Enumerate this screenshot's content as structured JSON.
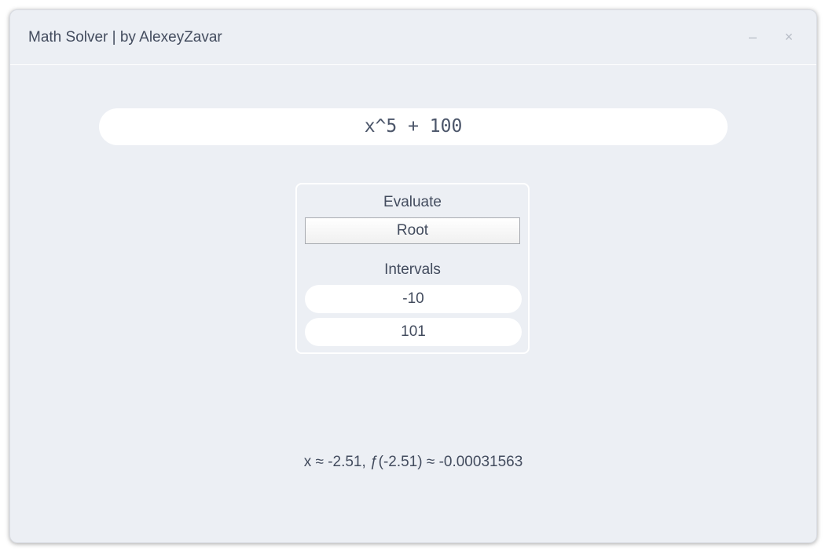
{
  "window": {
    "title": "Math Solver | by AlexeyZavar",
    "minimize_glyph": "–",
    "close_glyph": "×"
  },
  "expression": {
    "value": "x^5 + 100"
  },
  "panel": {
    "evaluate_label": "Evaluate",
    "evaluate_selected": "Root",
    "intervals_label": "Intervals",
    "interval_start": "-10",
    "interval_end": "101"
  },
  "result": {
    "text": "x ≈ -2.51, ƒ(-2.51) ≈ -0.00031563"
  },
  "colors": {
    "background": "#eceff4",
    "text": "#434c5e",
    "field": "#ffffff"
  }
}
